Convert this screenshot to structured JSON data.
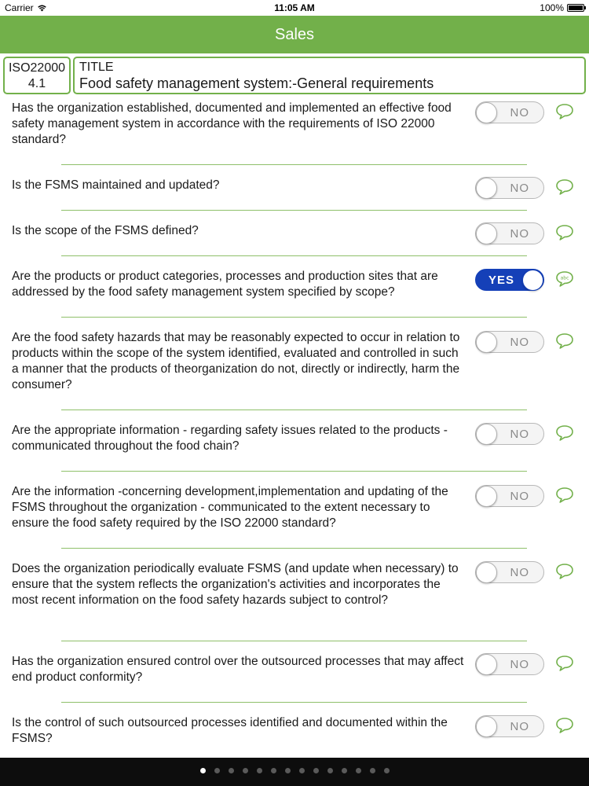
{
  "status_bar": {
    "carrier": "Carrier",
    "time": "11:05 AM",
    "battery": "100%"
  },
  "nav": {
    "title": "Sales"
  },
  "header": {
    "code": "ISO22000",
    "clause": "4.1",
    "title_label": "TITLE",
    "title": "Food safety management system:-General requirements"
  },
  "questions": [
    {
      "text": "Has the organization established, documented and implemented an effective food safety management system in accordance with the requirements of ISO 22000 standard?",
      "answer": "NO"
    },
    {
      "text": "Is the FSMS maintained and updated?",
      "answer": "NO"
    },
    {
      "text": "Is the scope of the FSMS defined?",
      "answer": "NO"
    },
    {
      "text": "Are the products or product categories, processes and production sites that are addressed by the food safety management system specified by scope?",
      "answer": "YES"
    },
    {
      "text": "Are the food safety hazards that may be reasonably expected to occur in relation to products within the scope of the system identified, evaluated and controlled in such a manner that the products of theorganization do not, directly or indirectly, harm the consumer?",
      "answer": "NO"
    },
    {
      "text": "Are the appropriate information - regarding safety issues related to the products - communicated throughout the food chain?",
      "answer": "NO"
    },
    {
      "text": "Are the information -concerning development,implementation and updating of the FSMS throughout the organization - communicated to the extent necessary to ensure the food safety required by the ISO 22000 standard?",
      "answer": "NO"
    },
    {
      "text": "Does the organization periodically evaluate FSMS (and update when necessary) to ensure that the system reflects the organization's activities and incorporates the most recent information on the food safety hazards subject to control?",
      "answer": "NO"
    },
    {
      "text": "Has the organization ensured control over the outsourced processes that may affect end product conformity?",
      "answer": "NO"
    },
    {
      "text": "Is the control of such outsourced processes identified and documented within the FSMS?",
      "answer": "NO"
    }
  ],
  "page_indicator": {
    "current": 1,
    "total": 14
  },
  "colors": {
    "accent": "#72b04a",
    "toggle_on": "#1540b8",
    "divider": "#8fc06a"
  },
  "icons": {
    "comment": "speech-bubble-icon",
    "comment_filled": "speech-bubble-abc-icon",
    "wifi": "wifi-icon",
    "battery": "battery-icon"
  }
}
